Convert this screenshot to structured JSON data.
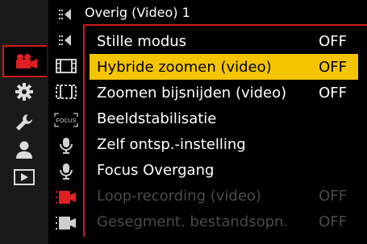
{
  "header": {
    "title": "Overig (Video) 1"
  },
  "main_categories": [
    {
      "icon": "movie-camera-icon",
      "selected": true
    },
    {
      "icon": "gear-icon",
      "selected": false
    },
    {
      "icon": "wrench-icon",
      "selected": false
    },
    {
      "icon": "person-icon",
      "selected": false
    },
    {
      "icon": "playback-icon",
      "selected": false
    }
  ],
  "sub_categories": [
    {
      "icon": "tab-arrow-icon"
    },
    {
      "icon": "tab-arrow-icon"
    },
    {
      "icon": "film-frame-icon"
    },
    {
      "icon": "film-frame-dashed-icon"
    },
    {
      "icon": "focus-icon",
      "label": "FOCUS"
    },
    {
      "icon": "microphone-icon"
    },
    {
      "icon": "microphone-icon"
    },
    {
      "icon": "red-camera-icon"
    },
    {
      "icon": "camera-icon"
    }
  ],
  "menu": {
    "items": [
      {
        "label": "Stille modus",
        "value": "OFF",
        "state": "normal"
      },
      {
        "label": "Hybride zoomen (video)",
        "value": "OFF",
        "state": "selected"
      },
      {
        "label": "Zoomen bijsnijden (video)",
        "value": "OFF",
        "state": "normal"
      },
      {
        "label": "Beeldstabilisatie",
        "value": "",
        "state": "normal"
      },
      {
        "label": "Zelf ontsp.-instelling",
        "value": "",
        "state": "normal"
      },
      {
        "label": "Focus Overgang",
        "value": "",
        "state": "normal"
      },
      {
        "label": "Loop-recording (video)",
        "value": "OFF",
        "state": "disabled"
      },
      {
        "label": "Gesegment. bestandsopn.",
        "value": "OFF",
        "state": "disabled"
      }
    ]
  },
  "colors": {
    "accent_red": "#d01a1a",
    "selection_yellow": "#f5c400",
    "disabled_gray": "#4a4a4a"
  }
}
